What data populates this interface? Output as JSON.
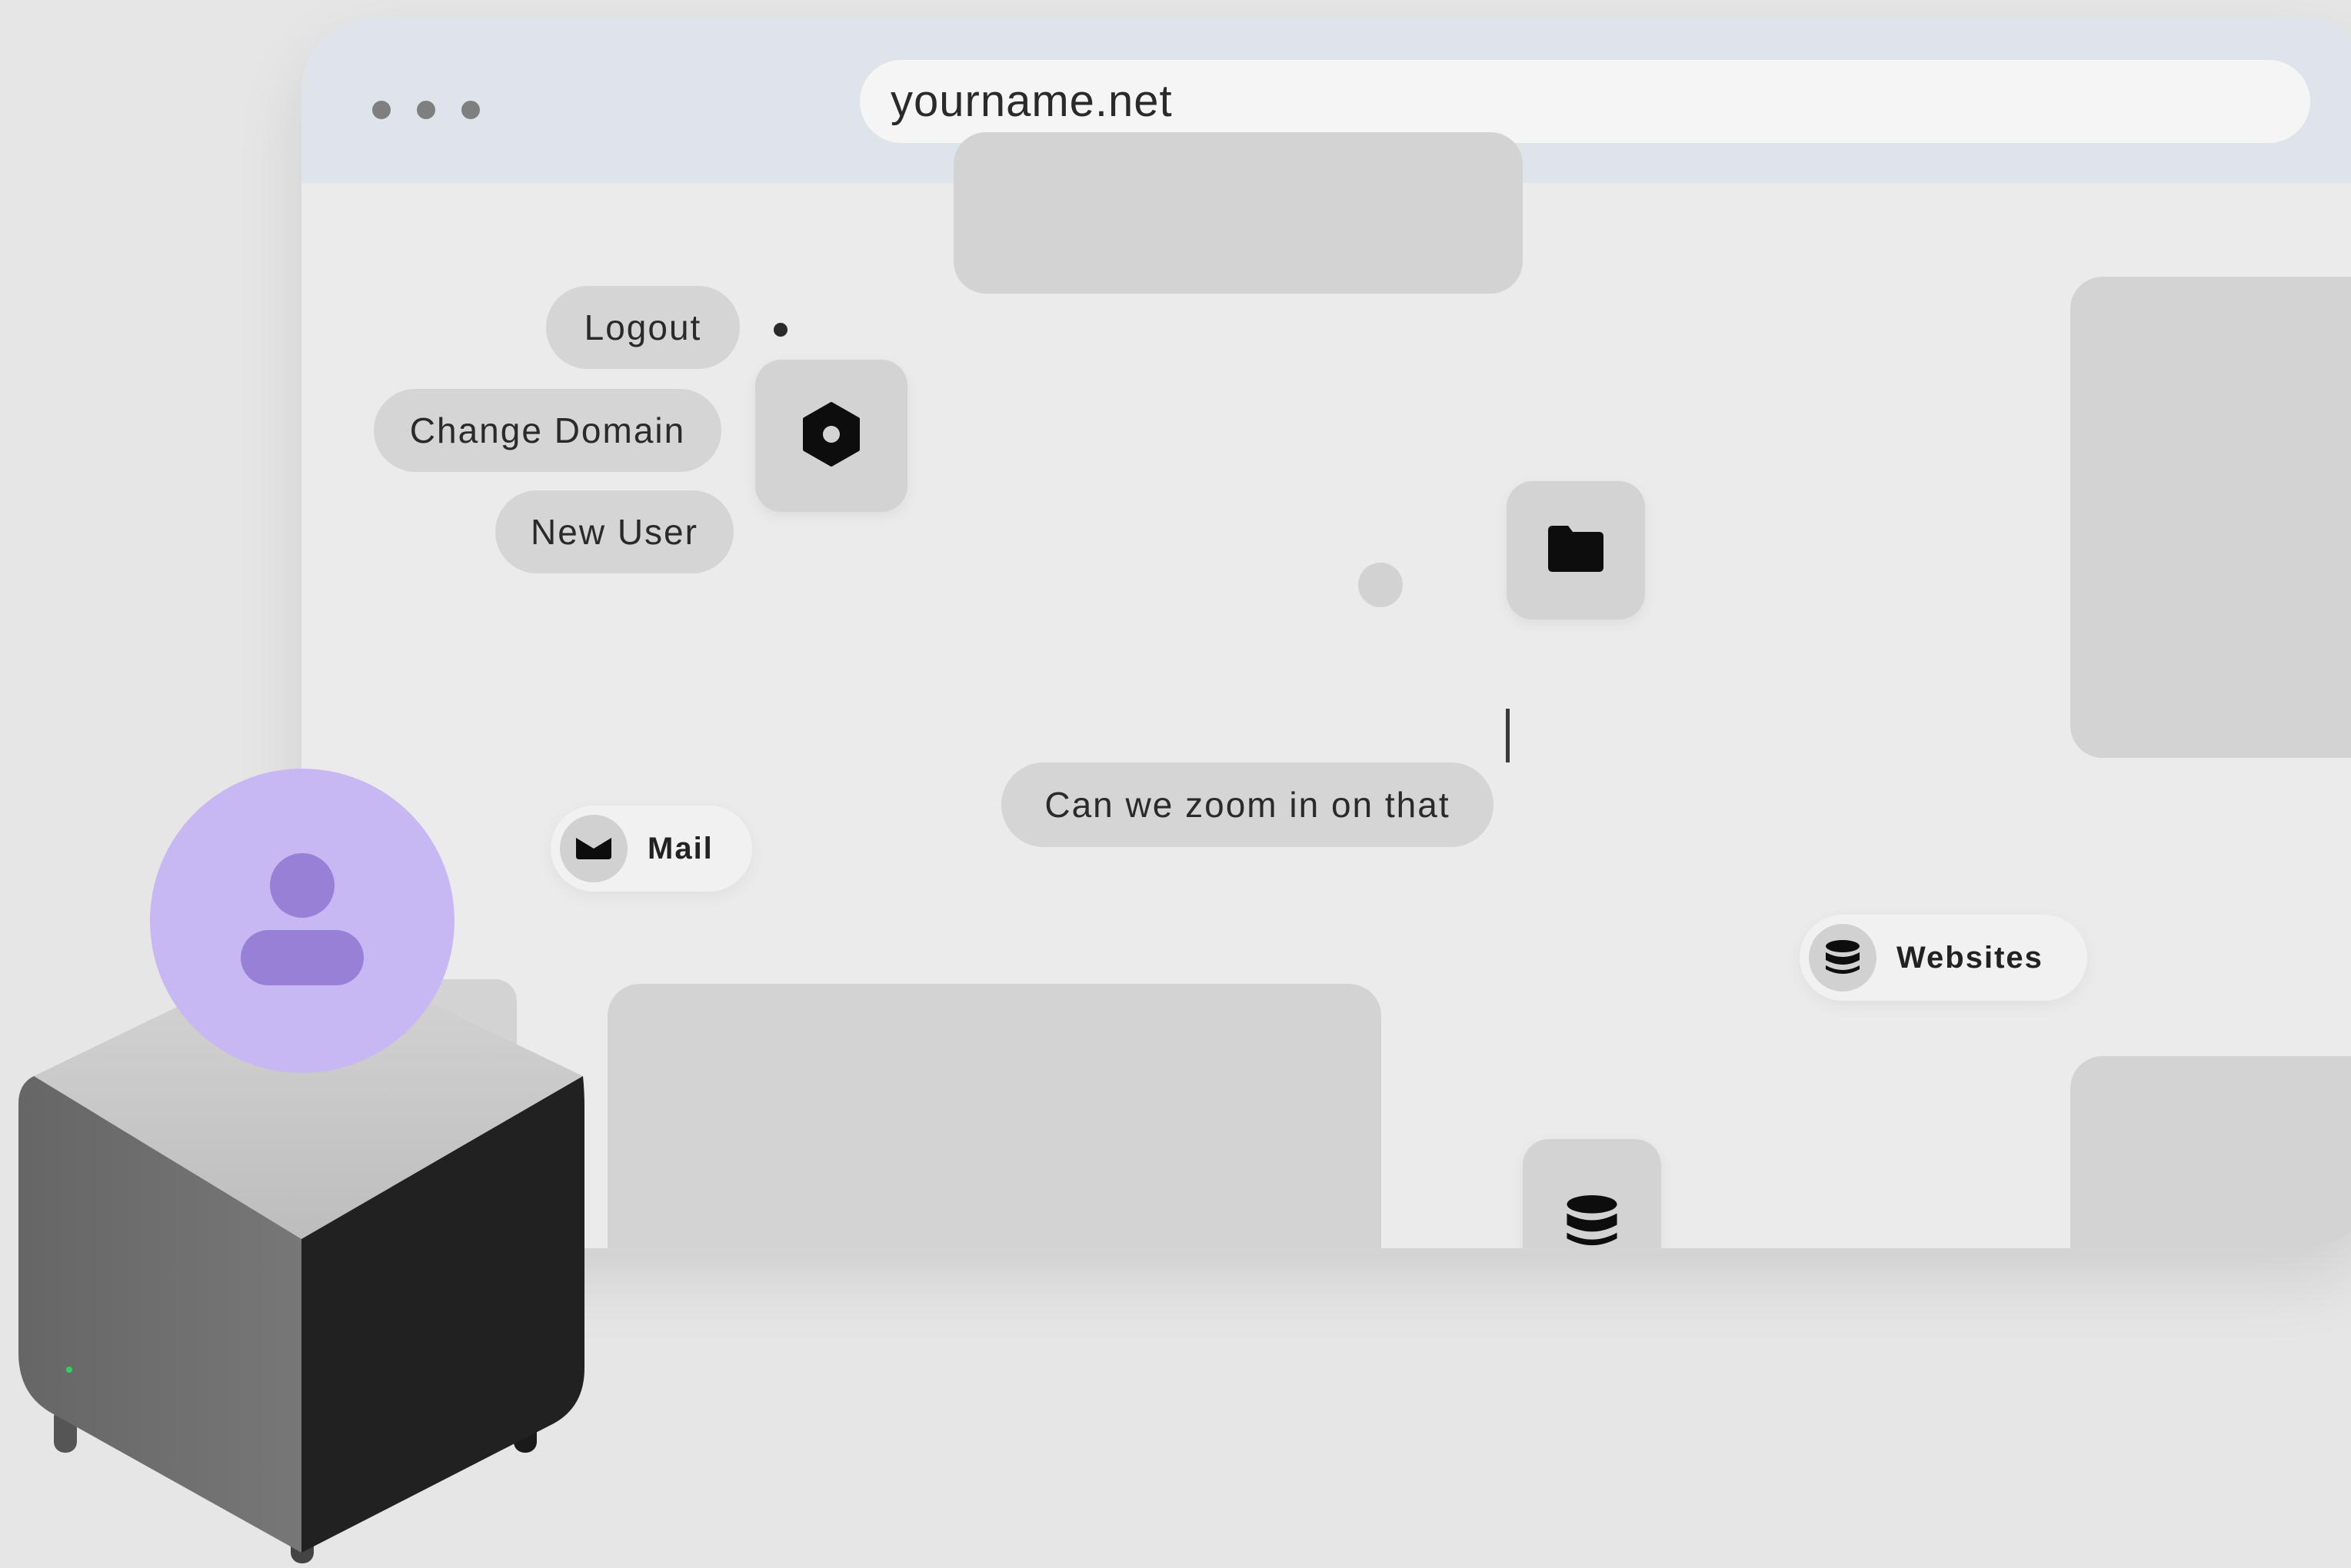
{
  "browser": {
    "url": "yourname.net"
  },
  "menu": {
    "logout_label": "Logout",
    "change_domain_label": "Change Domain",
    "new_user_label": "New User"
  },
  "chat": {
    "message": "Can we zoom in on that"
  },
  "chips": {
    "mail_label": "Mail",
    "websites_label": "Websites"
  },
  "icons": {
    "settings": "hexagon-settings-icon",
    "folder": "folder-icon",
    "mail": "mail-icon",
    "websites": "database-icon",
    "stack": "database-icon",
    "user": "user-icon"
  },
  "colors": {
    "avatar_bg": "#c7b8f3",
    "avatar_fg": "#9880d6",
    "status_led": "#35d05a"
  }
}
